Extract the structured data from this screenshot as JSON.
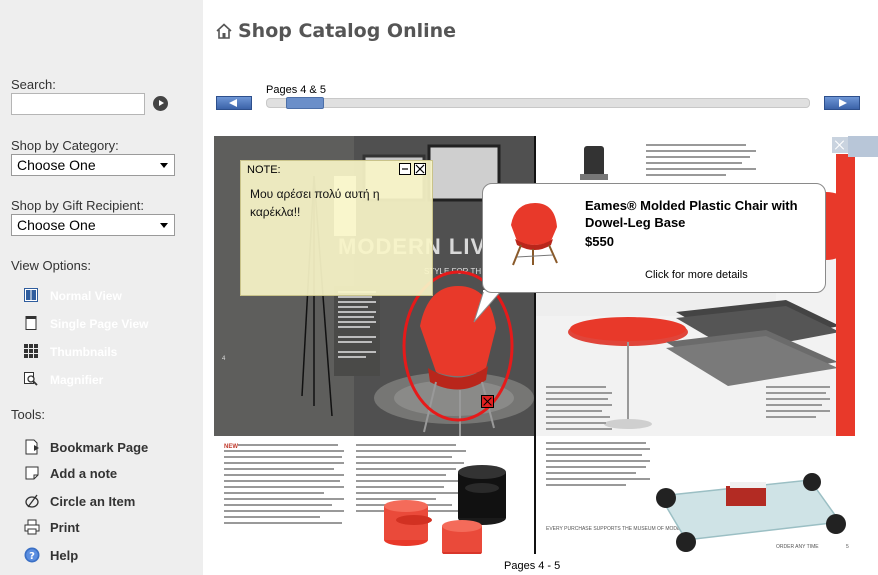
{
  "sidebar": {
    "search_label": "Search:",
    "category_label": "Shop by Category:",
    "category_selected": "Choose One",
    "recipient_label": "Shop by Gift Recipient:",
    "recipient_selected": "Choose One",
    "view_options_label": "View Options:",
    "view_options": [
      {
        "label": "Normal View",
        "icon": "normal-view-icon"
      },
      {
        "label": "Single Page View",
        "icon": "single-page-icon"
      },
      {
        "label": "Thumbnails",
        "icon": "thumbnails-icon"
      },
      {
        "label": "Magnifier",
        "icon": "magnifier-icon"
      }
    ],
    "tools_label": "Tools:",
    "tools": [
      {
        "label": "Bookmark Page",
        "icon": "bookmark-icon"
      },
      {
        "label": "Add a note",
        "icon": "note-icon"
      },
      {
        "label": "Circle an Item",
        "icon": "circle-item-icon"
      },
      {
        "label": "Print",
        "icon": "printer-icon"
      },
      {
        "label": "Help",
        "icon": "help-icon"
      }
    ]
  },
  "header": {
    "title": "Shop Catalog Online",
    "title_icon": "house-icon"
  },
  "navigator": {
    "pages_label": "Pages 4 & 5",
    "position": 0.04
  },
  "catalog": {
    "left_page_heading": "MODERN LIVI",
    "left_page_subheading": "STYLE FOR TH",
    "left_page_number": "4",
    "right_page_number": "5",
    "right_footer": "ORDER ANY TIME",
    "left_footer_caption": "NEW",
    "right_footer_caption": "EVERY PURCHASE SUPPORTS THE MUSEUM OF MODERN ART"
  },
  "note": {
    "title": "NOTE:",
    "text": "Μου αρέσει πολύ αυτή η καρέκλα!!"
  },
  "tooltip": {
    "product_name": "Eames® Molded Plastic Chair with Dowel-Leg Base",
    "price": "$550",
    "more": "Click for more details"
  },
  "footer": {
    "pages_label": "Pages 4 - 5"
  },
  "colors": {
    "sidebar_bg": "#eeeeee",
    "accent_blue": "#4c6fa8",
    "chair_red": "#e8392a",
    "note_bg": "#f8f5c8"
  }
}
